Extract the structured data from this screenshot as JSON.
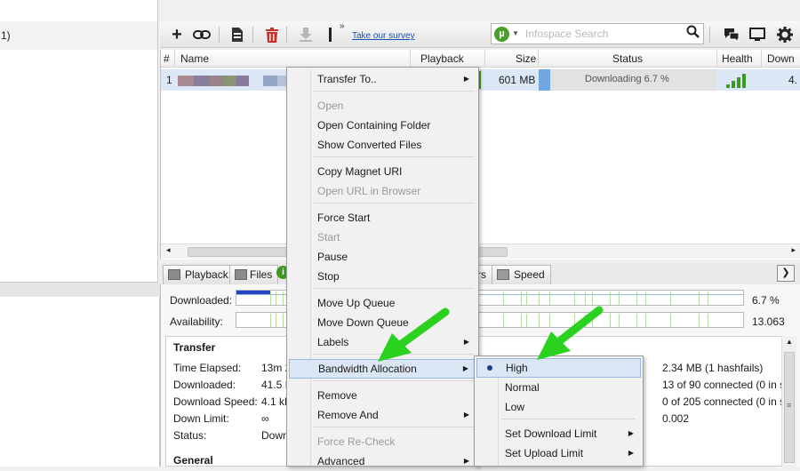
{
  "sidebar": {
    "row_text": "1)"
  },
  "toolbar": {
    "survey_label": "Take our survey",
    "survey_mark": "»",
    "search_placeholder": "Infospace Search",
    "icons": [
      "add-torrent-icon",
      "add-url-icon",
      "create-torrent-icon",
      "remove-icon",
      "download-icon",
      "more-icon",
      "chat-icon",
      "remote-icon",
      "settings-icon"
    ]
  },
  "table": {
    "columns": [
      "#",
      "Name",
      "Playback",
      "Size",
      "Status",
      "Health",
      "Down"
    ],
    "rows": [
      {
        "index": "1",
        "size": "601 MB",
        "status": "Downloading 6.7 %",
        "down": "4.",
        "progress": 0.067
      }
    ]
  },
  "tabs": [
    "Playback",
    "Files",
    "rs",
    "Speed"
  ],
  "general": {
    "downloaded_label": "Downloaded:",
    "downloaded_value": "6.7 %",
    "availability_label": "Availability:",
    "availability_value": "13.063",
    "transfer_heading": "Transfer",
    "general_heading": "General",
    "left_items": [
      {
        "label": "Time Elapsed:",
        "value": "13m 2"
      },
      {
        "label": "Downloaded:",
        "value": "41.5 M"
      },
      {
        "label": "Download Speed:",
        "value": "4.1 kE"
      },
      {
        "label": "Down Limit:",
        "value": "∞"
      },
      {
        "label": "Status:",
        "value": "Down"
      }
    ],
    "right_items": [
      "2.34 MB (1 hashfails)",
      "13 of 90 connected (0 in s",
      "0 of 205 connected (0 in s",
      "0.002"
    ]
  },
  "context_menu": {
    "items": [
      {
        "label": "Transfer To..",
        "submenu": true,
        "disabled": false
      },
      {
        "label": "Open",
        "disabled": true
      },
      {
        "label": "Open Containing Folder",
        "disabled": false
      },
      {
        "label": "Show Converted Files",
        "disabled": false
      },
      {
        "label": "Copy Magnet URI",
        "disabled": false
      },
      {
        "label": "Open URL in Browser",
        "disabled": true
      },
      {
        "label": "Force Start",
        "disabled": false
      },
      {
        "label": "Start",
        "disabled": true
      },
      {
        "label": "Pause",
        "disabled": false
      },
      {
        "label": "Stop",
        "disabled": false
      },
      {
        "label": "Move Up Queue",
        "disabled": false
      },
      {
        "label": "Move Down Queue",
        "disabled": false
      },
      {
        "label": "Labels",
        "submenu": true,
        "disabled": false
      },
      {
        "label": "Bandwidth Allocation",
        "submenu": true,
        "disabled": false,
        "active": true
      },
      {
        "label": "Remove",
        "disabled": false
      },
      {
        "label": "Remove And",
        "submenu": true,
        "disabled": false
      },
      {
        "label": "Force Re-Check",
        "disabled": true
      },
      {
        "label": "Advanced",
        "submenu": true,
        "disabled": false
      }
    ]
  },
  "bandwidth_submenu": {
    "items": [
      {
        "label": "High",
        "selected": true
      },
      {
        "label": "Normal"
      },
      {
        "label": "Low"
      },
      {
        "label": "Set Download Limit",
        "submenu": true
      },
      {
        "label": "Set Upload Limit",
        "submenu": true
      }
    ]
  },
  "colors": {
    "accent_green": "#2bd11f",
    "selection_blue": "#dce8f5",
    "health_green": "#3b9a1f"
  }
}
